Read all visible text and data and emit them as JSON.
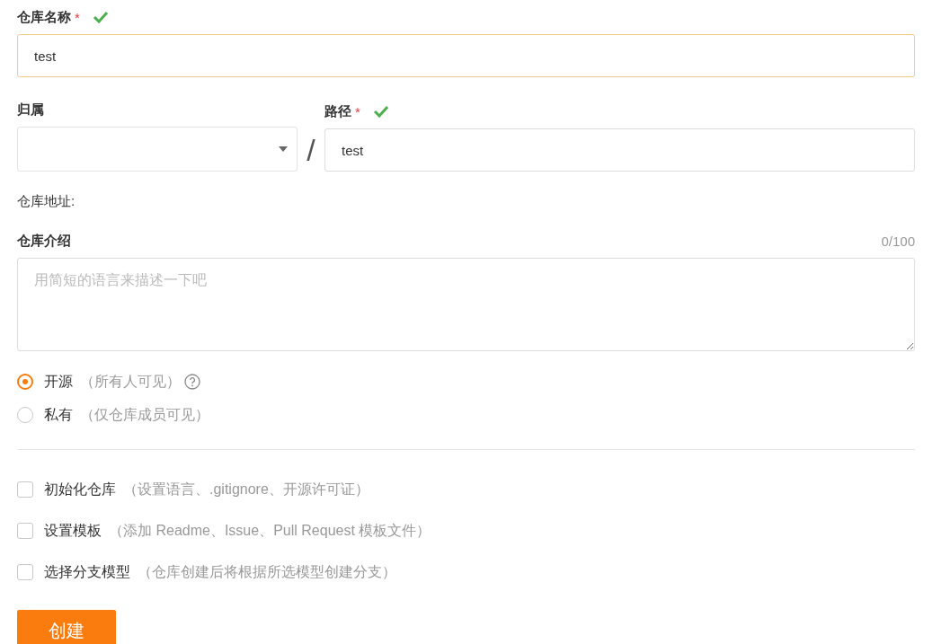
{
  "repo_name": {
    "label": "仓库名称",
    "required": "*",
    "valid": true,
    "value": "test",
    "focused": true
  },
  "owner": {
    "label": "归属"
  },
  "separator": "/",
  "path": {
    "label": "路径",
    "required": "*",
    "valid": true,
    "value": "test",
    "focused": false
  },
  "repo_address": {
    "label": "仓库地址:"
  },
  "description": {
    "label": "仓库介绍",
    "counter": "0/100",
    "placeholder": "用简短的语言来描述一下吧"
  },
  "visibility": [
    {
      "label": "开源",
      "note": "（所有人可见）",
      "selected": true,
      "help": true
    },
    {
      "label": "私有",
      "note": "（仅仓库成员可见）",
      "selected": false,
      "help": false
    }
  ],
  "options": [
    {
      "label": "初始化仓库",
      "note": "（设置语言、.gitignore、开源许可证）",
      "checked": false
    },
    {
      "label": "设置模板",
      "note": "（添加 Readme、Issue、Pull Request 模板文件）",
      "checked": false
    },
    {
      "label": "选择分支模型",
      "note": "（仓库创建后将根据所选模型创建分支）",
      "checked": false
    }
  ],
  "submit": "创建"
}
